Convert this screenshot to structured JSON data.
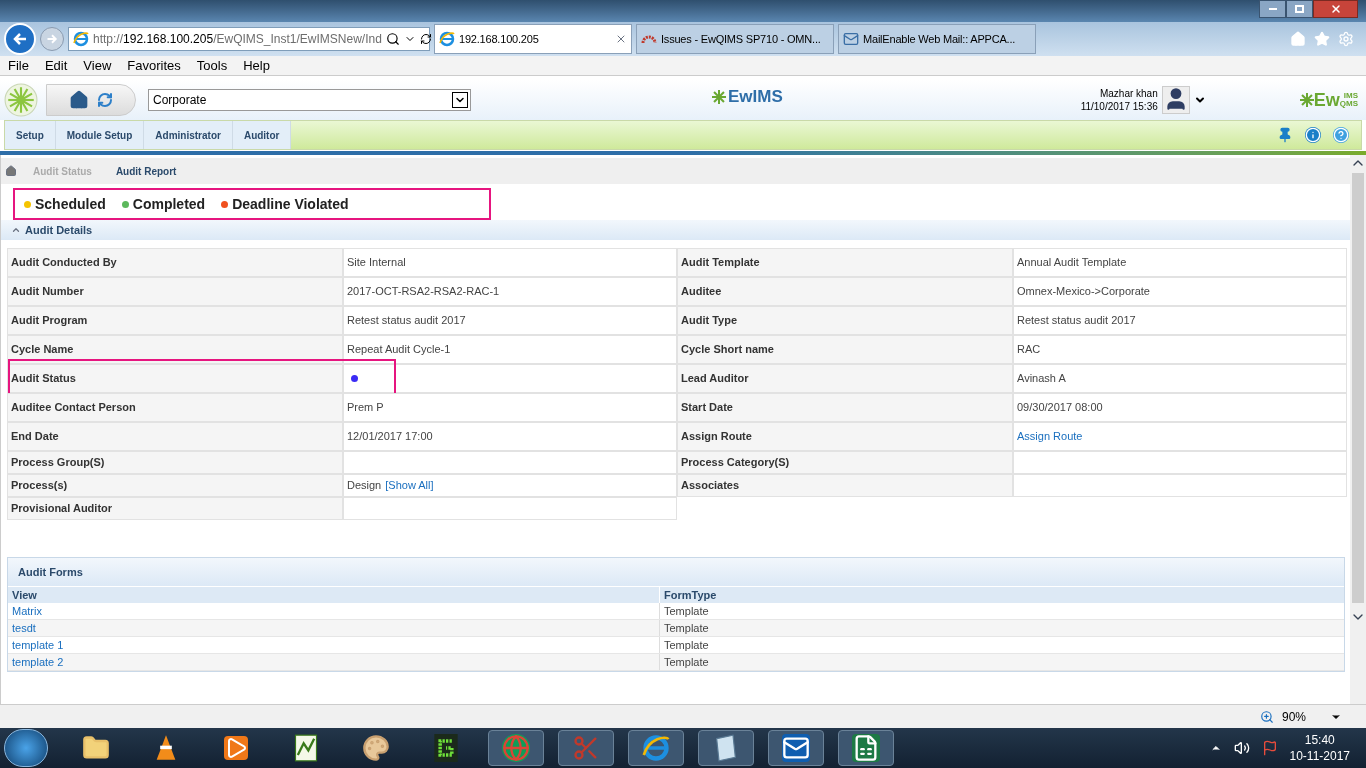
{
  "browser": {
    "address": {
      "scheme": "http://",
      "host": "192.168.100.205",
      "path": "/EwQIMS_Inst1/EwIMSNew/Ind"
    },
    "tabs": [
      {
        "title": "192.168.100.205",
        "selected": true,
        "kind": "ie"
      },
      {
        "title": "Issues - EwQIMS SP710 - OMN...",
        "selected": false,
        "kind": "issues"
      },
      {
        "title": "MailEnable Web Mail:: APPCA...",
        "selected": false,
        "kind": "mail"
      }
    ],
    "menu": [
      "File",
      "Edit",
      "View",
      "Favorites",
      "Tools",
      "Help"
    ]
  },
  "app_header": {
    "site": "Corporate",
    "center_logo": "EwIMS",
    "user": "Mazhar khan",
    "datetime": "11/10/2017 15:36",
    "right_logo": {
      "main": "Ew",
      "top": "IMS",
      "bottom": "QMS"
    }
  },
  "nav": [
    {
      "label": "Setup"
    },
    {
      "label": "Module Setup"
    },
    {
      "label": "Administrator"
    },
    {
      "label": "Auditor"
    }
  ],
  "breadcrumb": [
    {
      "label": "Audit Status",
      "selected": false
    },
    {
      "label": "Audit Report",
      "selected": true
    }
  ],
  "legend": [
    {
      "label": "Scheduled",
      "color": "#f5c400"
    },
    {
      "label": "Completed",
      "color": "#5cb85c"
    },
    {
      "label": "Deadline Violated",
      "color": "#f0501e"
    }
  ],
  "audit_details": {
    "title": "Audit Details",
    "rows": [
      [
        {
          "label": "Audit Conducted By",
          "kind": "text",
          "value": "Site Internal"
        },
        {
          "label": "Audit Template",
          "kind": "text",
          "value": "Annual Audit Template"
        }
      ],
      [
        {
          "label": "Audit Number",
          "kind": "text",
          "value": "2017-OCT-RSA2-RSA2-RAC-1"
        },
        {
          "label": "Auditee",
          "kind": "text",
          "value": "Omnex-Mexico->Corporate"
        }
      ],
      [
        {
          "label": "Audit Program",
          "kind": "text",
          "value": "Retest status audit 2017"
        },
        {
          "label": "Audit Type",
          "kind": "text",
          "value": "Retest status audit 2017"
        }
      ],
      [
        {
          "label": "Cycle Name",
          "kind": "text",
          "value": "Repeat Audit Cycle-1"
        },
        {
          "label": "Cycle Short name",
          "kind": "text",
          "value": "RAC"
        }
      ],
      [
        {
          "label": "Audit Status",
          "kind": "status",
          "color": "#3b2bf5",
          "highlighted": true
        },
        {
          "label": "Lead Auditor",
          "kind": "text",
          "value": "Avinash A"
        }
      ],
      [
        {
          "label": "Auditee Contact Person",
          "kind": "text",
          "value": "Prem P"
        },
        {
          "label": "Start Date",
          "kind": "text",
          "value": "09/30/2017 08:00"
        }
      ],
      [
        {
          "label": "End Date",
          "kind": "text",
          "value": "12/01/2017 17:00"
        },
        {
          "label": "Assign Route",
          "kind": "link",
          "value": "Assign Route"
        }
      ],
      [
        {
          "label": "Process Group(S)",
          "kind": "empty"
        },
        {
          "label": "Process Category(S)",
          "kind": "empty"
        }
      ],
      [
        {
          "label": "Process(s)",
          "kind": "process",
          "value": "Design",
          "link": "[Show All]"
        },
        {
          "label": "Associates",
          "kind": "empty"
        }
      ],
      [
        {
          "label": "Provisional Auditor",
          "kind": "empty"
        }
      ]
    ]
  },
  "audit_forms": {
    "title": "Audit Forms",
    "columns": [
      "View",
      "FormType"
    ],
    "rows": [
      {
        "view": "Matrix",
        "form_type": "Template"
      },
      {
        "view": "tesdt",
        "form_type": "Template"
      },
      {
        "view": "template 1",
        "form_type": "Template"
      },
      {
        "view": "template 2",
        "form_type": "Template"
      }
    ]
  },
  "status_bar": {
    "zoom": "90%"
  },
  "taskbar": {
    "time": "15:40",
    "date": "10-11-2017"
  }
}
